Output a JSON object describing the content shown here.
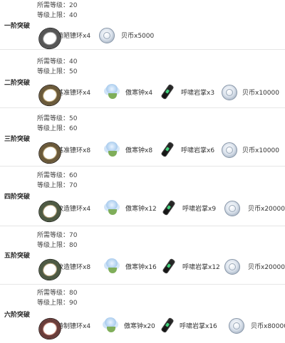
{
  "labels": {
    "req_level": "所需等级：",
    "cap_level": "等级上限："
  },
  "tiers": [
    {
      "name": "一阶突破",
      "req": "20",
      "cap": "40",
      "materials": [
        {
          "icon": "ring-icon",
          "text": "简陋镣环x4"
        },
        {
          "icon": "coin-icon",
          "text": "贝币x5000"
        }
      ]
    },
    {
      "name": "二阶突破",
      "req": "40",
      "cap": "50",
      "materials": [
        {
          "icon": "ring-icon",
          "text": "基准镣环x4"
        },
        {
          "icon": "flower-icon",
          "text": "傲寒钟x4"
        },
        {
          "icon": "gauntlet-icon",
          "text": "呼啸岩掌x3"
        },
        {
          "icon": "coin-icon",
          "text": "贝币x10000"
        }
      ]
    },
    {
      "name": "三阶突破",
      "req": "50",
      "cap": "60",
      "materials": [
        {
          "icon": "ring-icon",
          "text": "基准镣环x8"
        },
        {
          "icon": "flower-icon",
          "text": "傲寒钟x8"
        },
        {
          "icon": "gauntlet-icon",
          "text": "呼啸岩掌x6"
        },
        {
          "icon": "coin-icon",
          "text": "贝币x10000"
        }
      ]
    },
    {
      "name": "四阶突破",
      "req": "60",
      "cap": "70",
      "materials": [
        {
          "icon": "ring-icon",
          "text": "改造镣环x4"
        },
        {
          "icon": "flower-icon",
          "text": "傲寒钟x12"
        },
        {
          "icon": "gauntlet-icon",
          "text": "呼啸岩掌x9"
        },
        {
          "icon": "coin-icon",
          "text": "贝币x20000"
        }
      ]
    },
    {
      "name": "五阶突破",
      "req": "70",
      "cap": "80",
      "materials": [
        {
          "icon": "ring-icon",
          "text": "改造镣环x8"
        },
        {
          "icon": "flower-icon",
          "text": "傲寒钟x16"
        },
        {
          "icon": "gauntlet-icon",
          "text": "呼啸岩掌x12"
        },
        {
          "icon": "coin-icon",
          "text": "贝币x20000"
        }
      ]
    },
    {
      "name": "六阶突破",
      "req": "80",
      "cap": "90",
      "materials": [
        {
          "icon": "ring-icon",
          "text": "特制镣环x4"
        },
        {
          "icon": "flower-icon",
          "text": "傲寒钟x20"
        },
        {
          "icon": "gauntlet-icon",
          "text": "呼啸岩掌x16"
        },
        {
          "icon": "coin-icon",
          "text": "贝币x80000"
        }
      ]
    }
  ]
}
